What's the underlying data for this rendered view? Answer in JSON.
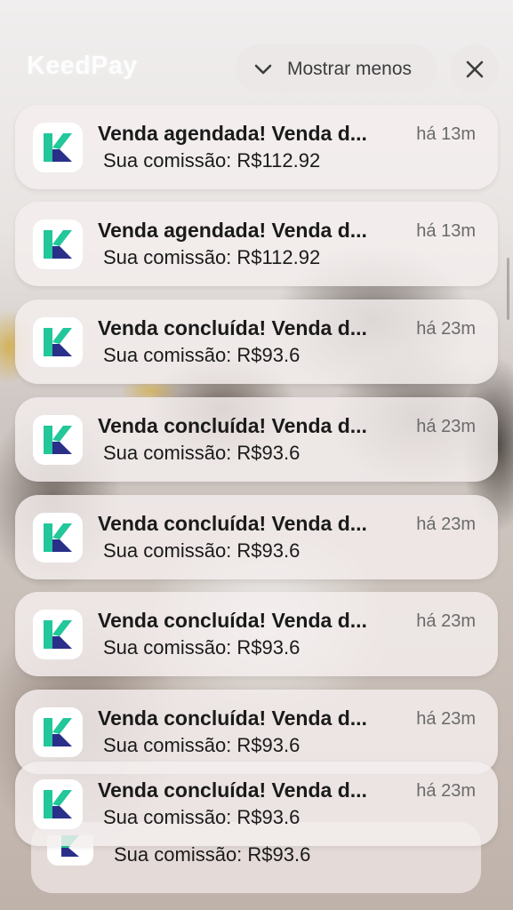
{
  "header": {
    "app_name": "KeedPay",
    "show_less_label": "Mostrar menos"
  },
  "icons": {
    "show_less": "chevron-down-icon",
    "close": "close-icon",
    "app": "keedpay-app-icon"
  },
  "colors": {
    "brand_green": "#22c79a",
    "brand_navy": "#2a2f8a"
  },
  "notifications": [
    {
      "title": "Venda agendada! Venda d...",
      "body": "Sua comissão: R$112.92",
      "time": "há 13m"
    },
    {
      "title": "Venda agendada! Venda d...",
      "body": "Sua comissão: R$112.92",
      "time": "há 13m"
    },
    {
      "title": "Venda concluída! Venda d...",
      "body": "Sua comissão: R$93.6",
      "time": "há 23m"
    },
    {
      "title": "Venda concluída! Venda d...",
      "body": "Sua comissão: R$93.6",
      "time": "há 23m"
    },
    {
      "title": "Venda concluída! Venda d...",
      "body": "Sua comissão: R$93.6",
      "time": "há 23m"
    },
    {
      "title": "Venda concluída! Venda d...",
      "body": "Sua comissão: R$93.6",
      "time": "há 23m"
    },
    {
      "title": "Venda concluída! Venda d...",
      "body": "Sua comissão: R$93.6",
      "time": "há 23m"
    },
    {
      "title": "Venda concluída! Venda d...",
      "body": "Sua comissão: R$93.6",
      "time": "há 23m"
    }
  ],
  "stacked_notification": {
    "body": "Sua comissão: R$93.6"
  }
}
